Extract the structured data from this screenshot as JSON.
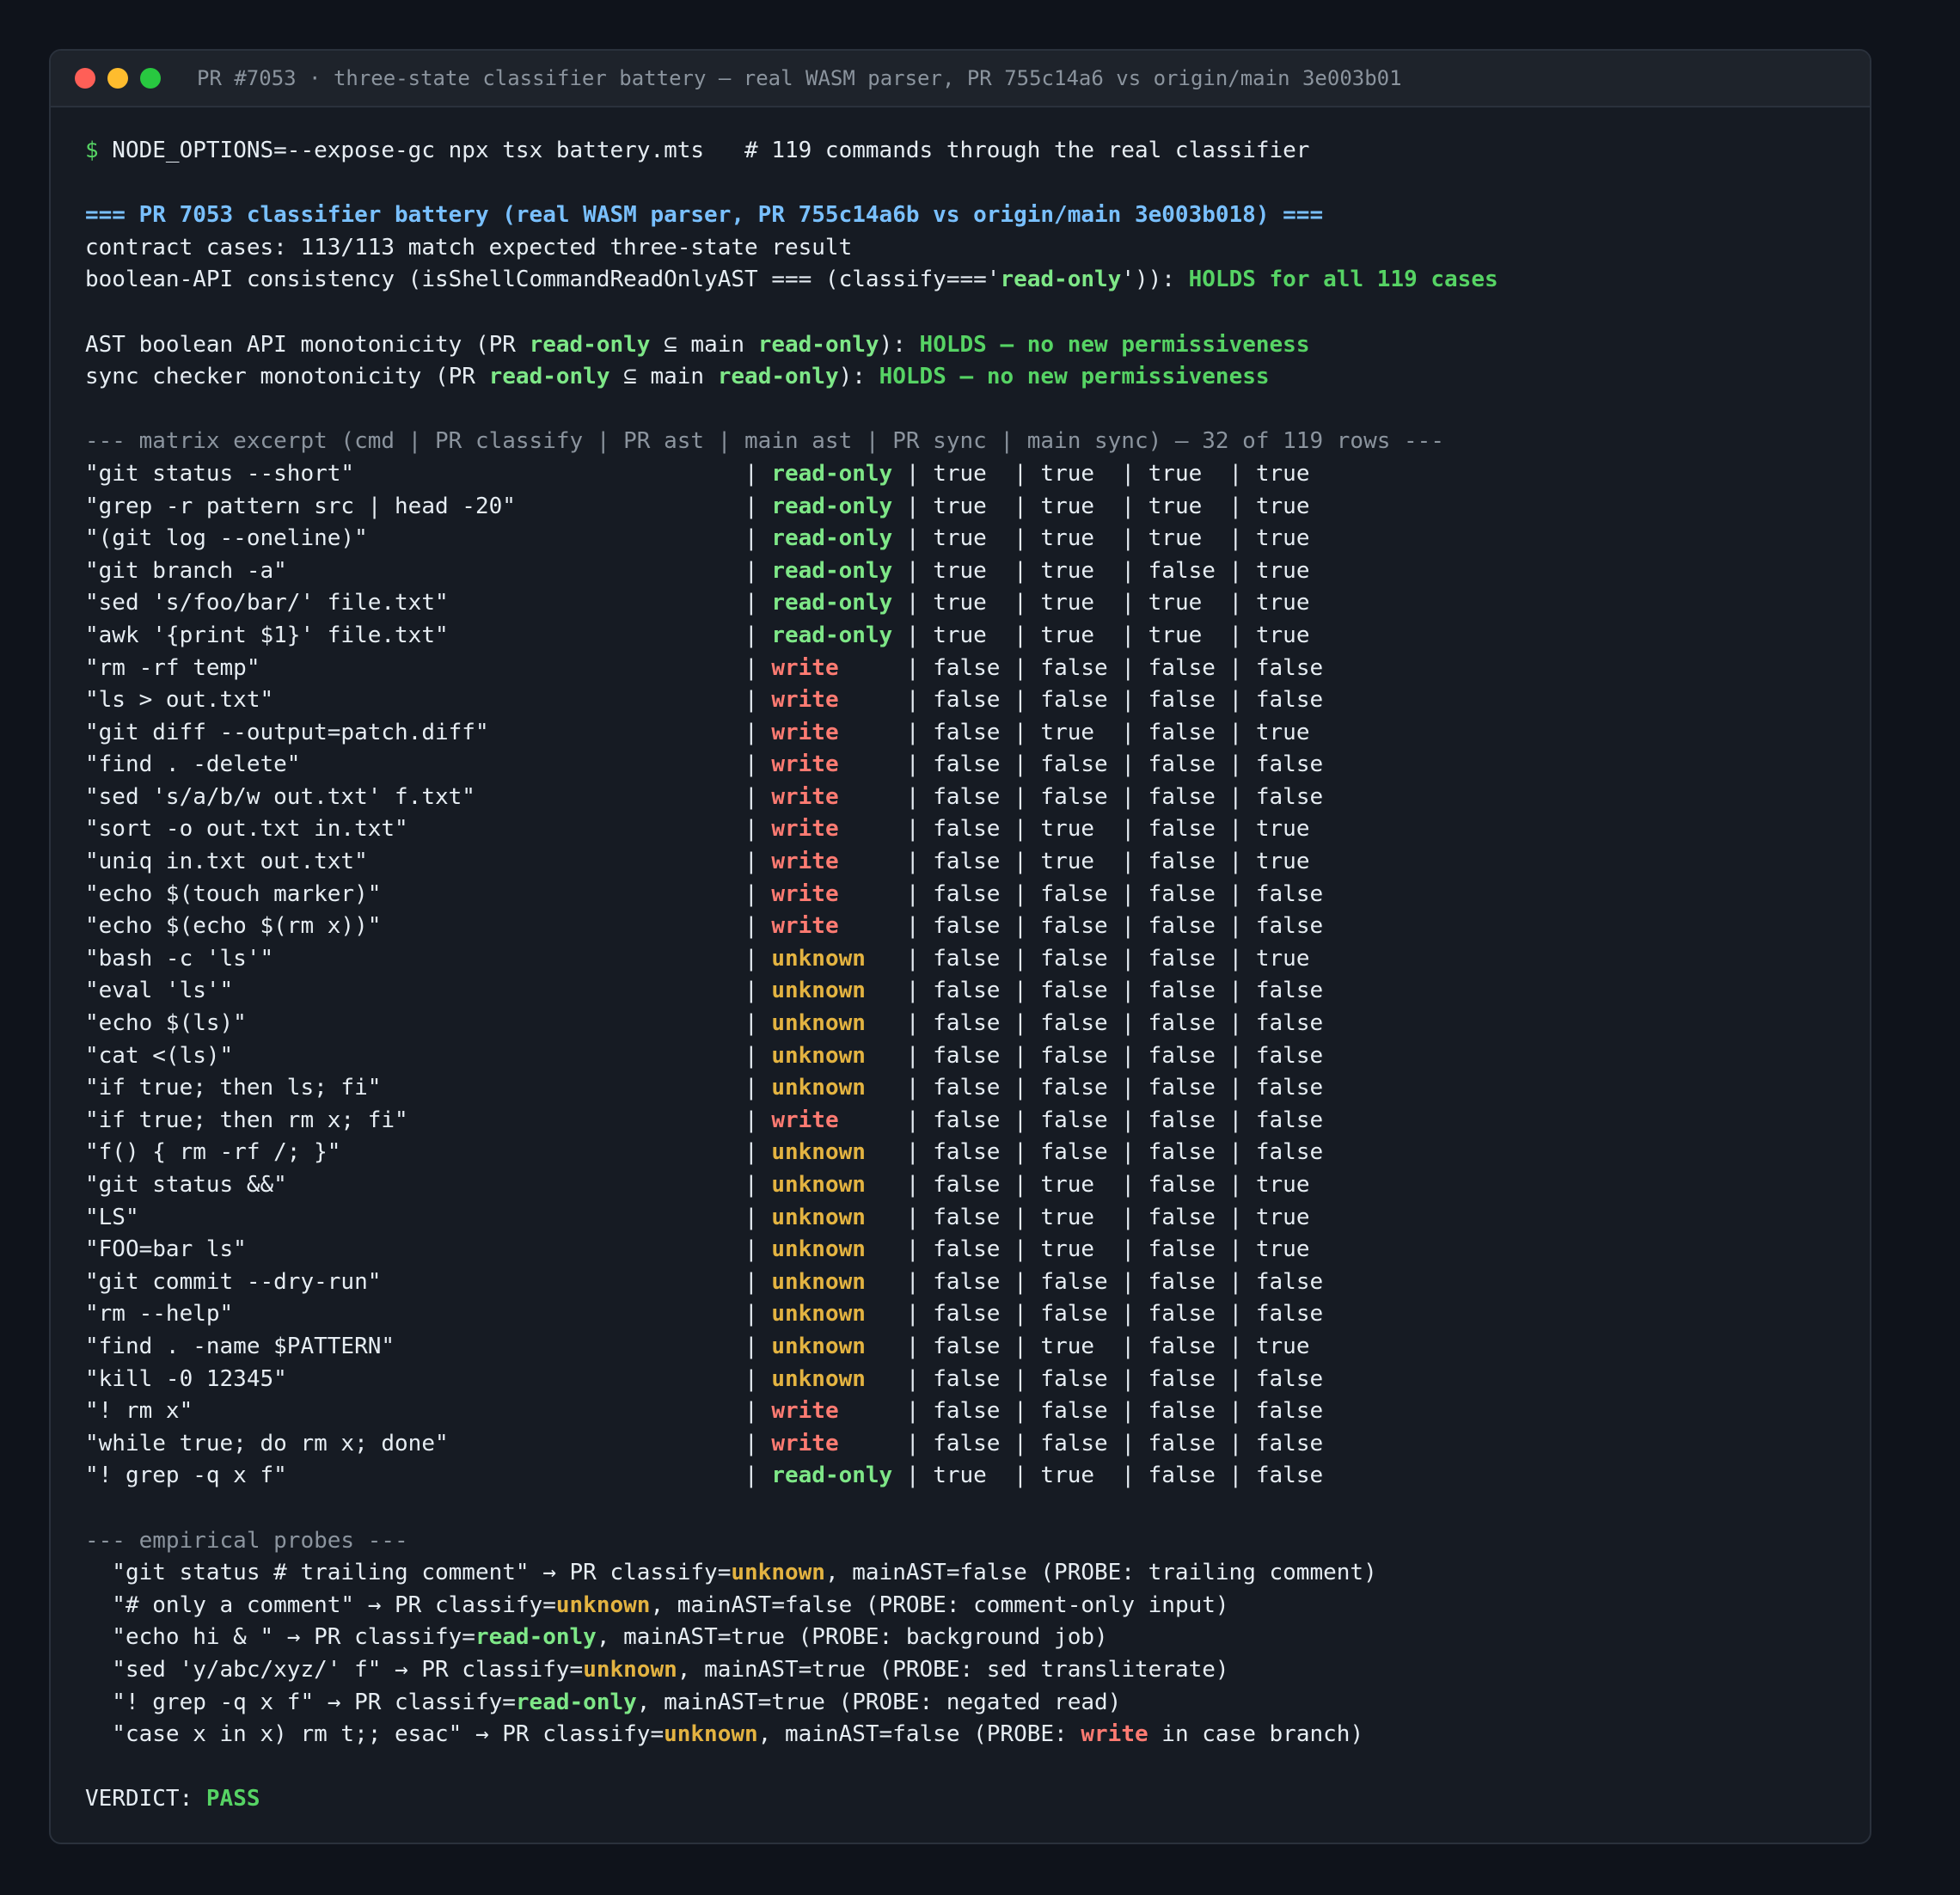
{
  "window": {
    "title": "PR #7053 · three-state classifier battery — real WASM parser, PR 755c14a6 vs origin/main 3e003b01"
  },
  "command": {
    "prompt": "$",
    "text": " NODE_OPTIONS=--expose-gc npx tsx battery.mts   # 119 commands through the real classifier"
  },
  "summary": {
    "header": "=== PR 7053 classifier battery (real WASM parser, PR 755c14a6b vs origin/main 3e003b018) ===",
    "contract": "contract cases: 113/113 match expected three-state result",
    "consistency_prefix": "boolean-API consistency (isShellCommandReadOnlyAST === (classify==='",
    "consistency_state": "read-only",
    "consistency_mid": "')): ",
    "consistency_result": "HOLDS for all 119 cases",
    "mono_ast_prefix": "AST boolean API monotonicity (PR ",
    "mono_sync_prefix": "sync checker monotonicity (PR ",
    "mono_state": "read-only",
    "mono_mid": " ⊆ main ",
    "mono_suffix": "): ",
    "mono_result": "HOLDS — no new permissiveness"
  },
  "matrix": {
    "header": "--- matrix excerpt (cmd | PR classify | PR ast | main ast | PR sync | main sync) — 32 of 119 rows ---",
    "rows": [
      {
        "cmd": "\"git status --short\"",
        "state": "read-only",
        "cls": "ro",
        "rest": "true  | true  | true  | true"
      },
      {
        "cmd": "\"grep -r pattern src | head -20\"",
        "state": "read-only",
        "cls": "ro",
        "rest": "true  | true  | true  | true"
      },
      {
        "cmd": "\"(git log --oneline)\"",
        "state": "read-only",
        "cls": "ro",
        "rest": "true  | true  | true  | true"
      },
      {
        "cmd": "\"git branch -a\"",
        "state": "read-only",
        "cls": "ro",
        "rest": "true  | true  | false | true"
      },
      {
        "cmd": "\"sed 's/foo/bar/' file.txt\"",
        "state": "read-only",
        "cls": "ro",
        "rest": "true  | true  | true  | true"
      },
      {
        "cmd": "\"awk '{print $1}' file.txt\"",
        "state": "read-only",
        "cls": "ro",
        "rest": "true  | true  | true  | true"
      },
      {
        "cmd": "\"rm -rf temp\"",
        "state": "write    ",
        "cls": "wr",
        "rest": "false | false | false | false"
      },
      {
        "cmd": "\"ls > out.txt\"",
        "state": "write    ",
        "cls": "wr",
        "rest": "false | false | false | false"
      },
      {
        "cmd": "\"git diff --output=patch.diff\"",
        "state": "write    ",
        "cls": "wr",
        "rest": "false | true  | false | true"
      },
      {
        "cmd": "\"find . -delete\"",
        "state": "write    ",
        "cls": "wr",
        "rest": "false | false | false | false"
      },
      {
        "cmd": "\"sed 's/a/b/w out.txt' f.txt\"",
        "state": "write    ",
        "cls": "wr",
        "rest": "false | false | false | false"
      },
      {
        "cmd": "\"sort -o out.txt in.txt\"",
        "state": "write    ",
        "cls": "wr",
        "rest": "false | true  | false | true"
      },
      {
        "cmd": "\"uniq in.txt out.txt\"",
        "state": "write    ",
        "cls": "wr",
        "rest": "false | true  | false | true"
      },
      {
        "cmd": "\"echo $(touch marker)\"",
        "state": "write    ",
        "cls": "wr",
        "rest": "false | false | false | false"
      },
      {
        "cmd": "\"echo $(echo $(rm x))\"",
        "state": "write    ",
        "cls": "wr",
        "rest": "false | false | false | false"
      },
      {
        "cmd": "\"bash -c 'ls'\"",
        "state": "unknown  ",
        "cls": "un",
        "rest": "false | false | false | true"
      },
      {
        "cmd": "\"eval 'ls'\"",
        "state": "unknown  ",
        "cls": "un",
        "rest": "false | false | false | false"
      },
      {
        "cmd": "\"echo $(ls)\"",
        "state": "unknown  ",
        "cls": "un",
        "rest": "false | false | false | false"
      },
      {
        "cmd": "\"cat <(ls)\"",
        "state": "unknown  ",
        "cls": "un",
        "rest": "false | false | false | false"
      },
      {
        "cmd": "\"if true; then ls; fi\"",
        "state": "unknown  ",
        "cls": "un",
        "rest": "false | false | false | false"
      },
      {
        "cmd": "\"if true; then rm x; fi\"",
        "state": "write    ",
        "cls": "wr",
        "rest": "false | false | false | false"
      },
      {
        "cmd": "\"f() { rm -rf /; }\"",
        "state": "unknown  ",
        "cls": "un",
        "rest": "false | false | false | false"
      },
      {
        "cmd": "\"git status &&\"",
        "state": "unknown  ",
        "cls": "un",
        "rest": "false | true  | false | true"
      },
      {
        "cmd": "\"LS\"",
        "state": "unknown  ",
        "cls": "un",
        "rest": "false | true  | false | true"
      },
      {
        "cmd": "\"FOO=bar ls\"",
        "state": "unknown  ",
        "cls": "un",
        "rest": "false | true  | false | true"
      },
      {
        "cmd": "\"git commit --dry-run\"",
        "state": "unknown  ",
        "cls": "un",
        "rest": "false | false | false | false"
      },
      {
        "cmd": "\"rm --help\"",
        "state": "unknown  ",
        "cls": "un",
        "rest": "false | false | false | false"
      },
      {
        "cmd": "\"find . -name $PATTERN\"",
        "state": "unknown  ",
        "cls": "un",
        "rest": "false | true  | false | true"
      },
      {
        "cmd": "\"kill -0 12345\"",
        "state": "unknown  ",
        "cls": "un",
        "rest": "false | false | false | false"
      },
      {
        "cmd": "\"! rm x\"",
        "state": "write    ",
        "cls": "wr",
        "rest": "false | false | false | false"
      },
      {
        "cmd": "\"while true; do rm x; done\"",
        "state": "write    ",
        "cls": "wr",
        "rest": "false | false | false | false"
      },
      {
        "cmd": "\"! grep -q x f\"",
        "state": "read-only",
        "cls": "ro",
        "rest": "true  | true  | false | false"
      }
    ]
  },
  "probes": {
    "header": "--- empirical probes ---",
    "rows": [
      {
        "cmd": "  \"git status # trailing comment\" → PR classify=",
        "state": "unknown",
        "cls": "un",
        "main": ", mainAST=false (PROBE: ",
        "note": "trailing comment",
        "note_pre": "",
        "note_cls": "",
        "note_post": ")"
      },
      {
        "cmd": "  \"# only a comment\" → PR classify=",
        "state": "unknown",
        "cls": "un",
        "main": ", mainAST=false (PROBE: ",
        "note": "comment-only input",
        "note_pre": "",
        "note_cls": "",
        "note_post": ")"
      },
      {
        "cmd": "  \"echo hi & \" → PR classify=",
        "state": "read-only",
        "cls": "ro",
        "main": ", mainAST=true (PROBE: ",
        "note": "background job",
        "note_pre": "",
        "note_cls": "",
        "note_post": ")"
      },
      {
        "cmd": "  \"sed 'y/abc/xyz/' f\" → PR classify=",
        "state": "unknown",
        "cls": "un",
        "main": ", mainAST=true (PROBE: ",
        "note": "sed transliterate",
        "note_pre": "",
        "note_cls": "",
        "note_post": ")"
      },
      {
        "cmd": "  \"! grep -q x f\" → PR classify=",
        "state": "read-only",
        "cls": "ro",
        "main": ", mainAST=true (PROBE: ",
        "note": "negated read",
        "note_pre": "",
        "note_cls": "",
        "note_post": ")"
      },
      {
        "cmd": "  \"case x in x) rm t;; esac\" → PR classify=",
        "state": "unknown",
        "cls": "un",
        "main": ", mainAST=false (PROBE: ",
        "note": " in case branch",
        "note_pre": "write",
        "note_cls": "wr",
        "note_post": ")"
      }
    ]
  },
  "verdict": {
    "label": "VERDICT: ",
    "value": "PASS"
  },
  "colors": {
    "background": "#0f131b",
    "terminal": "#161b23",
    "read_only": "#7ee787",
    "write": "#ff7b72",
    "unknown": "#e3b341",
    "header": "#79c0ff"
  }
}
